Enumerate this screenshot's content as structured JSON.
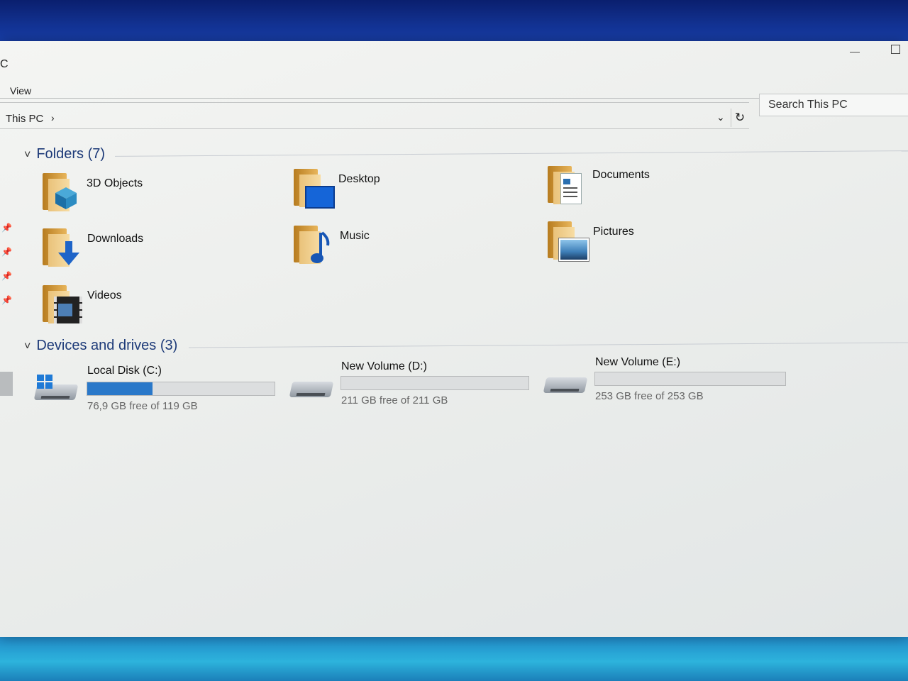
{
  "window": {
    "title": "C"
  },
  "ribbon": {
    "view_tab": "View"
  },
  "address": {
    "breadcrumb": "This PC",
    "arrow": "›",
    "dropdown": "⌄",
    "refresh": "↻"
  },
  "search": {
    "placeholder": "Search This PC"
  },
  "groups": {
    "folders": {
      "title": "Folders (7)",
      "chevron": "˅"
    },
    "devices": {
      "title": "Devices and drives (3)",
      "chevron": "˅"
    }
  },
  "folders": [
    {
      "label": "3D Objects",
      "icon": "3d-objects-icon"
    },
    {
      "label": "Desktop",
      "icon": "desktop-folder-icon"
    },
    {
      "label": "Documents",
      "icon": "documents-folder-icon"
    },
    {
      "label": "Downloads",
      "icon": "downloads-folder-icon"
    },
    {
      "label": "Music",
      "icon": "music-folder-icon"
    },
    {
      "label": "Pictures",
      "icon": "pictures-folder-icon"
    },
    {
      "label": "Videos",
      "icon": "videos-folder-icon"
    }
  ],
  "drives": [
    {
      "label": "Local Disk (C:)",
      "free": "76,9 GB free of 119 GB",
      "used_fraction": 0.35
    },
    {
      "label": "New Volume (D:)",
      "free": "211 GB free of 211 GB",
      "used_fraction": 0.0
    },
    {
      "label": "New Volume (E:)",
      "free": "253 GB free of 253 GB",
      "used_fraction": 0.0
    }
  ],
  "colors": {
    "accent": "#2a78c9",
    "group_header": "#1d3a78"
  }
}
